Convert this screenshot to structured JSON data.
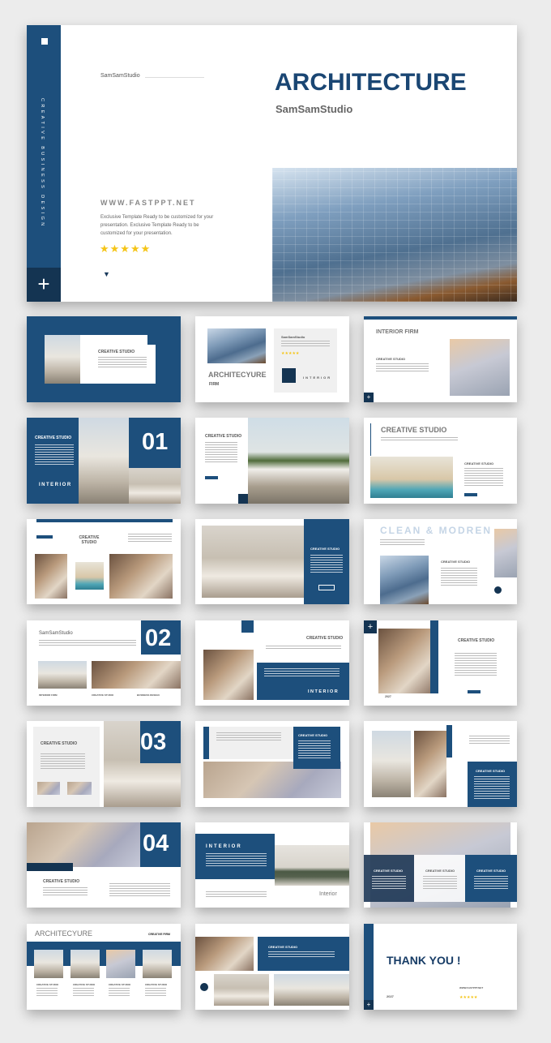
{
  "hero": {
    "sidebar_vertical_text": "CREATIVE BUSINESS DESIGN",
    "brand": "SamSamStudio",
    "title": "ARCHITECTURE",
    "subtitle": "SamSamStudio",
    "website": "WWW.FASTPPT.NET",
    "description": "Exclusive Template Ready to be customized for your presentation. Exclusive Template Ready to be customized for your presentation.",
    "rating": 5,
    "stars": "★★★★★",
    "plus_icon": "plus-icon",
    "arrow_icon": "triangle-down-icon",
    "accent_color": "#1d4f7c",
    "star_color": "#f5c518"
  },
  "slides": {
    "s1": {
      "label": "CREATIVE STUDIO"
    },
    "s2": {
      "title": "ARCHITECYURE",
      "sub": "FIRM",
      "brand": "SamSamStudio",
      "stars": "★★★★★",
      "tag": "INTERIOR"
    },
    "s3": {
      "title": "INTERIOR FIRM",
      "label": "CREATIVE STUDIO"
    },
    "s4": {
      "label": "CREATIVE STUDIO",
      "number": "01",
      "tag": "INTERIOR"
    },
    "s5": {
      "label": "CREATIVE STUDIO"
    },
    "s6": {
      "title": "CREATIVE STUDIO",
      "label": "CREATIVE STUDIO"
    },
    "s7": {
      "label": "CREATIVE STUDIO"
    },
    "s8": {
      "label": "CREATIVE STUDIO"
    },
    "s9": {
      "title": "CLEAN & MODREN",
      "label": "CREATIVE STUDIO"
    },
    "s10": {
      "title": "SamSamStudio",
      "number": "02",
      "captions": [
        "INTERIOR FIRM",
        "CREATIVE STUDIO",
        "BUSINESS DESIGN"
      ]
    },
    "s11": {
      "label": "CREATIVE STUDIO",
      "tag": "INTERIOR"
    },
    "s12": {
      "label": "CREATIVE STUDIO",
      "year": "2027"
    },
    "s13": {
      "label": "CREATIVE STUDIO",
      "number": "03"
    },
    "s14": {
      "label": "CREATIVE STUDIO"
    },
    "s15": {
      "label": "CREATIVE STUDIO"
    },
    "s16": {
      "label": "CREATIVE STUDIO",
      "number": "04"
    },
    "s17": {
      "title": "INTERIOR",
      "sign": "Interior"
    },
    "s18": {
      "labels": [
        "CREATIVE STUDIO",
        "CREATIVE STUDIO",
        "CREATIVE STUDIO"
      ]
    },
    "s19": {
      "title": "ARCHITECYURE",
      "sub": "CREATIVE FIRM",
      "labels": [
        "CREATIVE STUDIO",
        "CREATIVE STUDIO",
        "CREATIVE STUDIO",
        "CREATIVE STUDIO"
      ]
    },
    "s20": {
      "label": "CREATIVE STUDIO"
    },
    "s21": {
      "title": "THANK YOU !",
      "year": "2027",
      "website": "WWW.FASTPPT.NET",
      "stars": "★★★★★"
    }
  }
}
